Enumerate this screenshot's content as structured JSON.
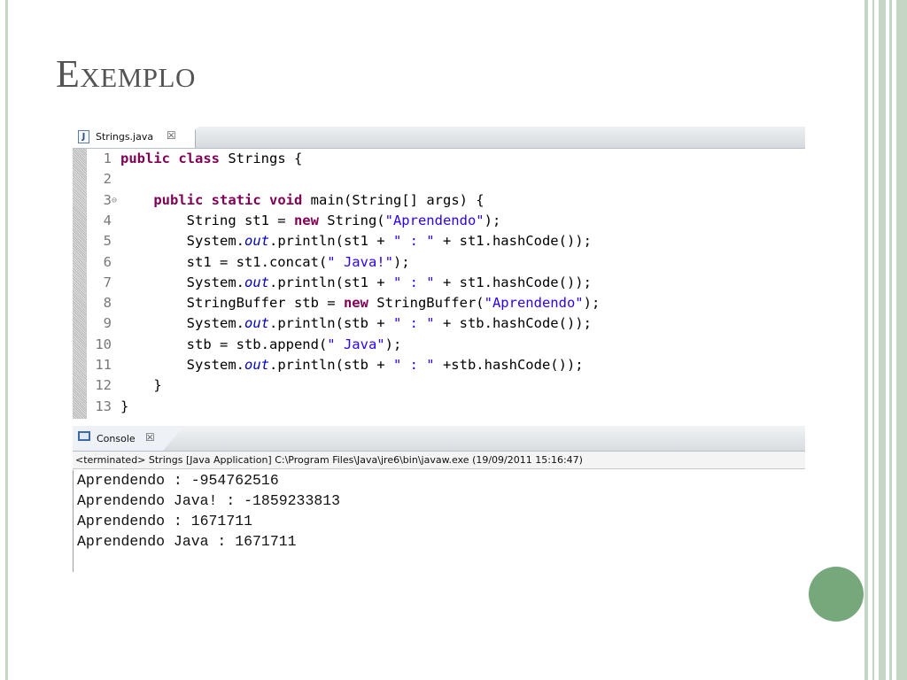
{
  "slide": {
    "title": "Exemplo",
    "colors": {
      "accent_circle": "#76a87c",
      "frame_stripes": "#c5d6c5"
    }
  },
  "editor": {
    "tab": {
      "icon": "java-file-icon",
      "icon_glyph": "J",
      "label": "Strings.java",
      "close_glyph": "☒"
    },
    "fold_marker": "⊖",
    "lines": [
      {
        "num": "1",
        "tokens": [
          {
            "t": "kw",
            "v": "public"
          },
          {
            "t": "p",
            "v": " "
          },
          {
            "t": "kw",
            "v": "class"
          },
          {
            "t": "p",
            "v": " Strings {"
          }
        ]
      },
      {
        "num": "2",
        "tokens": []
      },
      {
        "num": "3",
        "fold": true,
        "tokens": [
          {
            "t": "p",
            "v": "    "
          },
          {
            "t": "kw",
            "v": "public"
          },
          {
            "t": "p",
            "v": " "
          },
          {
            "t": "kw",
            "v": "static"
          },
          {
            "t": "p",
            "v": " "
          },
          {
            "t": "kw",
            "v": "void"
          },
          {
            "t": "p",
            "v": " main(String[] args) {"
          }
        ]
      },
      {
        "num": "4",
        "tokens": [
          {
            "t": "p",
            "v": "        String st1 = "
          },
          {
            "t": "kw",
            "v": "new"
          },
          {
            "t": "p",
            "v": " String("
          },
          {
            "t": "str",
            "v": "\"Aprendendo\""
          },
          {
            "t": "p",
            "v": ");"
          }
        ]
      },
      {
        "num": "5",
        "tokens": [
          {
            "t": "p",
            "v": "        System."
          },
          {
            "t": "fld",
            "v": "out"
          },
          {
            "t": "p",
            "v": ".println(st1 + "
          },
          {
            "t": "str",
            "v": "\" : \""
          },
          {
            "t": "p",
            "v": " + st1.hashCode());"
          }
        ]
      },
      {
        "num": "6",
        "tokens": [
          {
            "t": "p",
            "v": "        st1 = st1.concat("
          },
          {
            "t": "str",
            "v": "\" Java!\""
          },
          {
            "t": "p",
            "v": ");"
          }
        ]
      },
      {
        "num": "7",
        "tokens": [
          {
            "t": "p",
            "v": "        System."
          },
          {
            "t": "fld",
            "v": "out"
          },
          {
            "t": "p",
            "v": ".println(st1 + "
          },
          {
            "t": "str",
            "v": "\" : \""
          },
          {
            "t": "p",
            "v": " + st1.hashCode());"
          }
        ]
      },
      {
        "num": "8",
        "tokens": [
          {
            "t": "p",
            "v": "        StringBuffer stb = "
          },
          {
            "t": "kw",
            "v": "new"
          },
          {
            "t": "p",
            "v": " StringBuffer("
          },
          {
            "t": "str",
            "v": "\"Aprendendo\""
          },
          {
            "t": "p",
            "v": ");"
          }
        ]
      },
      {
        "num": "9",
        "tokens": [
          {
            "t": "p",
            "v": "        System."
          },
          {
            "t": "fld",
            "v": "out"
          },
          {
            "t": "p",
            "v": ".println(stb + "
          },
          {
            "t": "str",
            "v": "\" : \""
          },
          {
            "t": "p",
            "v": " + stb.hashCode());"
          }
        ]
      },
      {
        "num": "10",
        "tokens": [
          {
            "t": "p",
            "v": "        stb = stb.append("
          },
          {
            "t": "str",
            "v": "\" Java\""
          },
          {
            "t": "p",
            "v": ");"
          }
        ]
      },
      {
        "num": "11",
        "tokens": [
          {
            "t": "p",
            "v": "        System."
          },
          {
            "t": "fld",
            "v": "out"
          },
          {
            "t": "p",
            "v": ".println(stb + "
          },
          {
            "t": "str",
            "v": "\" : \""
          },
          {
            "t": "p",
            "v": " +stb.hashCode());"
          }
        ]
      },
      {
        "num": "12",
        "tokens": [
          {
            "t": "p",
            "v": "    }"
          }
        ]
      },
      {
        "num": "13",
        "tokens": [
          {
            "t": "p",
            "v": "}"
          }
        ]
      }
    ]
  },
  "console": {
    "tab": {
      "icon": "console-icon",
      "label": "Console",
      "close_glyph": "☒"
    },
    "status": "<terminated> Strings [Java Application] C:\\Program Files\\Java\\jre6\\bin\\javaw.exe (19/09/2011 15:16:47)",
    "output": [
      "Aprendendo : -954762516",
      "Aprendendo Java! : -1859233813",
      "Aprendendo : 1671711",
      "Aprendendo Java : 1671711"
    ]
  }
}
